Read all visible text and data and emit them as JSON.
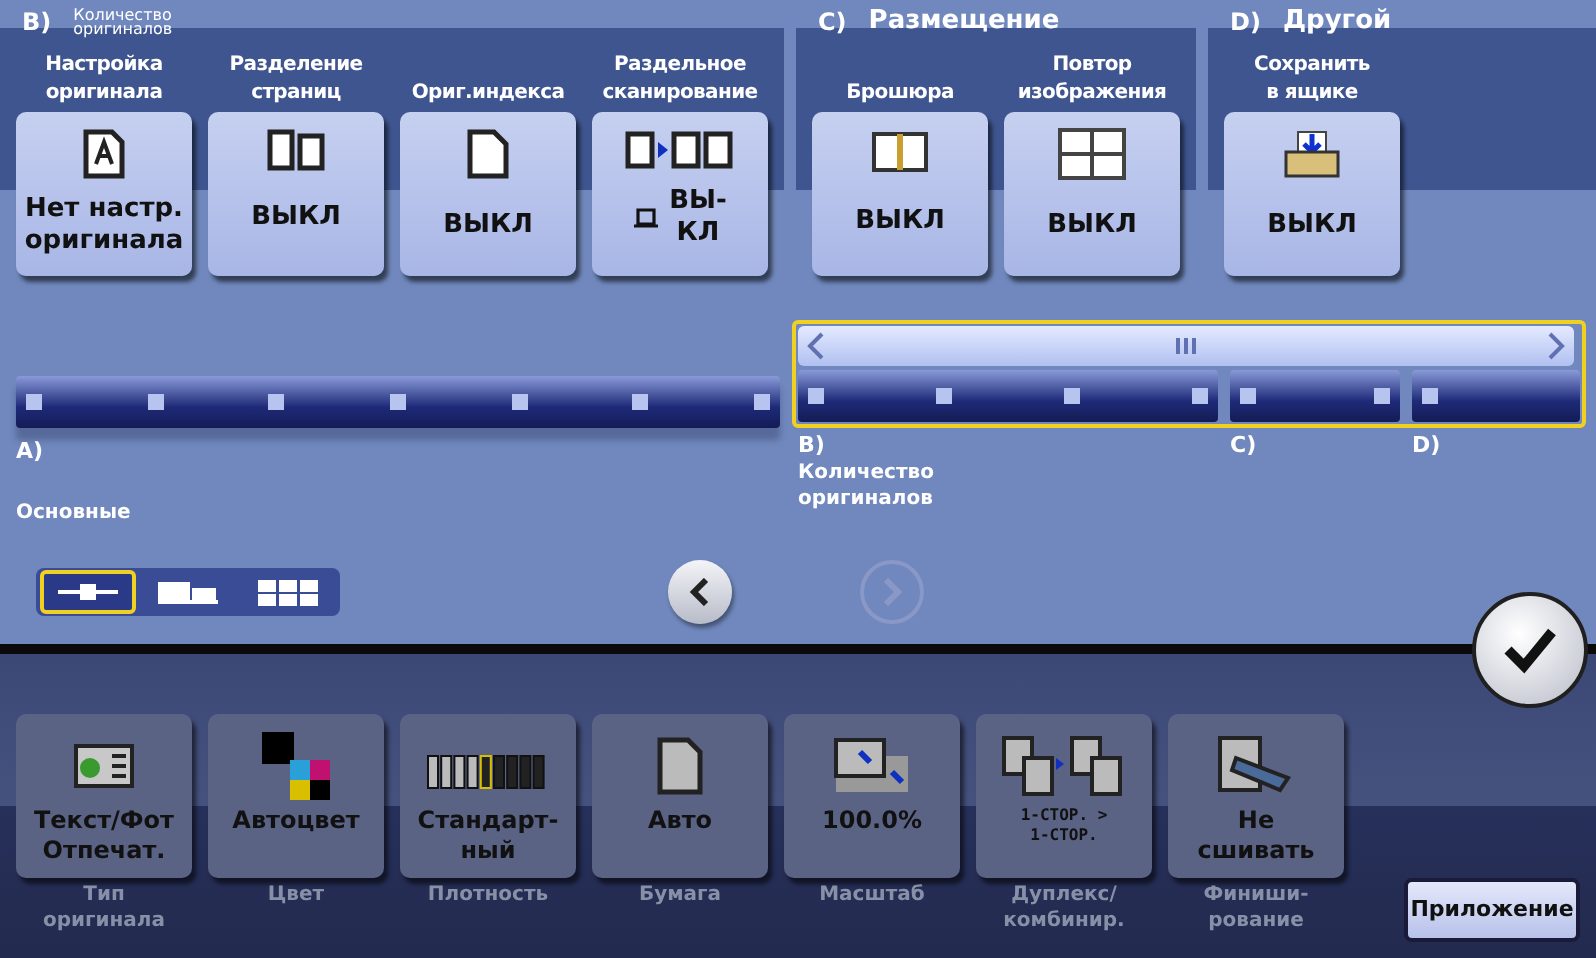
{
  "groups": [
    {
      "letter": "B)",
      "title": "Количество\nоригиналов",
      "buttons": [
        {
          "caption": "Настройка\nоригинала",
          "value": "Нет настр.\nоригинала",
          "kind": "original"
        },
        {
          "caption": "Разделение\nстраниц",
          "value": "ВЫКЛ",
          "kind": "split"
        },
        {
          "caption": "Ориг.индекса",
          "value": "ВЫКЛ",
          "kind": "index"
        },
        {
          "caption": "Раздельное\nсканирование",
          "value": "ВЫ-\nКЛ",
          "kind": "separate"
        }
      ]
    },
    {
      "letter": "C)",
      "title": "Размещение",
      "buttons": [
        {
          "caption": "Брошюра",
          "value": "ВЫКЛ",
          "kind": "booklet"
        },
        {
          "caption": "Повтор\nизображения",
          "value": "ВЫКЛ",
          "kind": "repeat"
        }
      ]
    },
    {
      "letter": "D)",
      "title": "Другой",
      "buttons": [
        {
          "caption": "Сохранить\nв ящике",
          "value": "ВЫКЛ",
          "kind": "box"
        }
      ]
    }
  ],
  "navigator": {
    "segments": [
      {
        "label": "A)",
        "name": "Основные",
        "in_view": false
      },
      {
        "label": "B)",
        "name": "Количество\nоригиналов",
        "in_view": true
      },
      {
        "label": "C)",
        "in_view": true
      },
      {
        "label": "D)",
        "in_view": true
      }
    ]
  },
  "view_modes": [
    {
      "kind": "slider",
      "selected": true
    },
    {
      "kind": "cards",
      "selected": false
    },
    {
      "kind": "grid",
      "selected": false
    }
  ],
  "pager": {
    "prev": {
      "disabled": false
    },
    "next": {
      "disabled": true
    }
  },
  "settings": [
    {
      "value": "Текст/Фот\nОтпечат.",
      "label": "Тип\nоригинала",
      "kind": "textphoto"
    },
    {
      "value": "Автоцвет",
      "label": "Цвет",
      "kind": "color"
    },
    {
      "value": "Стандарт-\nный",
      "label": "Плотность",
      "kind": "density"
    },
    {
      "value": "Авто",
      "label": "Бумага",
      "kind": "paper"
    },
    {
      "value": "100.0%",
      "label": "Масштаб",
      "kind": "zoom"
    },
    {
      "value": "1-СТОР. >\n1-СТОР.",
      "label": "Дуплекс/\nкомбинир.",
      "kind": "duplex"
    },
    {
      "value": "Не\nсшивать",
      "label": "Финиши-\nрование",
      "kind": "staple"
    }
  ],
  "app_button": "Приложение"
}
